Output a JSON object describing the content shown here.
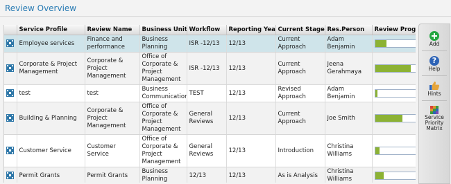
{
  "page": {
    "title": "Review Overview"
  },
  "table": {
    "columns": [
      "Service Profile",
      "Review Name",
      "Business Unit",
      "Workflow",
      "Reporting Year",
      "Current Stage",
      "Res.Person",
      "Review Progress"
    ],
    "rows": [
      {
        "service_profile": "Employee services",
        "review_name": "Finance and performance",
        "business_unit": "Business Planning",
        "workflow": "ISR -12/13",
        "reporting_year": "12/13",
        "current_stage": "Current Approach",
        "res_person": "Adam Benjamin",
        "progress": 0.28,
        "selected": true
      },
      {
        "service_profile": "Corporate & Project Management",
        "review_name": "Corporate & Project Management",
        "business_unit": "Office of Corporate & Project Management",
        "workflow": "ISR -12/13",
        "reporting_year": "12/13",
        "current_stage": "Current Approach",
        "res_person": "Jeena Gerahmaya",
        "progress": 0.85,
        "selected": false
      },
      {
        "service_profile": "test",
        "review_name": "test",
        "business_unit": "Business Communications",
        "workflow": "TEST",
        "reporting_year": "12/13",
        "current_stage": "Revised Approach",
        "res_person": "Adam Benjamin",
        "progress": 0.05,
        "selected": false
      },
      {
        "service_profile": "Building & Planning",
        "review_name": "Corporate & Project Management",
        "business_unit": "Office of Corporate & Project Management",
        "workflow": "General Reviews",
        "reporting_year": "12/13",
        "current_stage": "Current Approach",
        "res_person": "Joe Smith",
        "progress": 0.65,
        "selected": false
      },
      {
        "service_profile": "Customer Service",
        "review_name": "Customer Service",
        "business_unit": "Office of Corporate & Project Management",
        "workflow": "General Reviews",
        "reporting_year": "12/13",
        "current_stage": "Introduction",
        "res_person": "Christina Williams",
        "progress": 0.1,
        "selected": false
      },
      {
        "service_profile": "Permit Grants",
        "review_name": "Permit Grants",
        "business_unit": "Business Planning",
        "workflow": "12/13",
        "reporting_year": "12/13",
        "current_stage": "As is Analysis",
        "res_person": "Christina Williams",
        "progress": 0.2,
        "selected": false
      }
    ]
  },
  "sidebar": {
    "add": {
      "label": "Add",
      "icon": "add-icon"
    },
    "help": {
      "label": "Help",
      "icon": "help-icon",
      "glyph": "?"
    },
    "hints": {
      "label": "Hints",
      "icon": "thumbs-up-icon"
    },
    "matrix": {
      "label": "Service Priority Matrix",
      "icon": "matrix-icon"
    }
  },
  "colors": {
    "title": "#2a7cb4",
    "selected_row": "#cfe4ea",
    "progress_fill": "#8cb234",
    "add": "#23a640",
    "help": "#2d63b6"
  }
}
